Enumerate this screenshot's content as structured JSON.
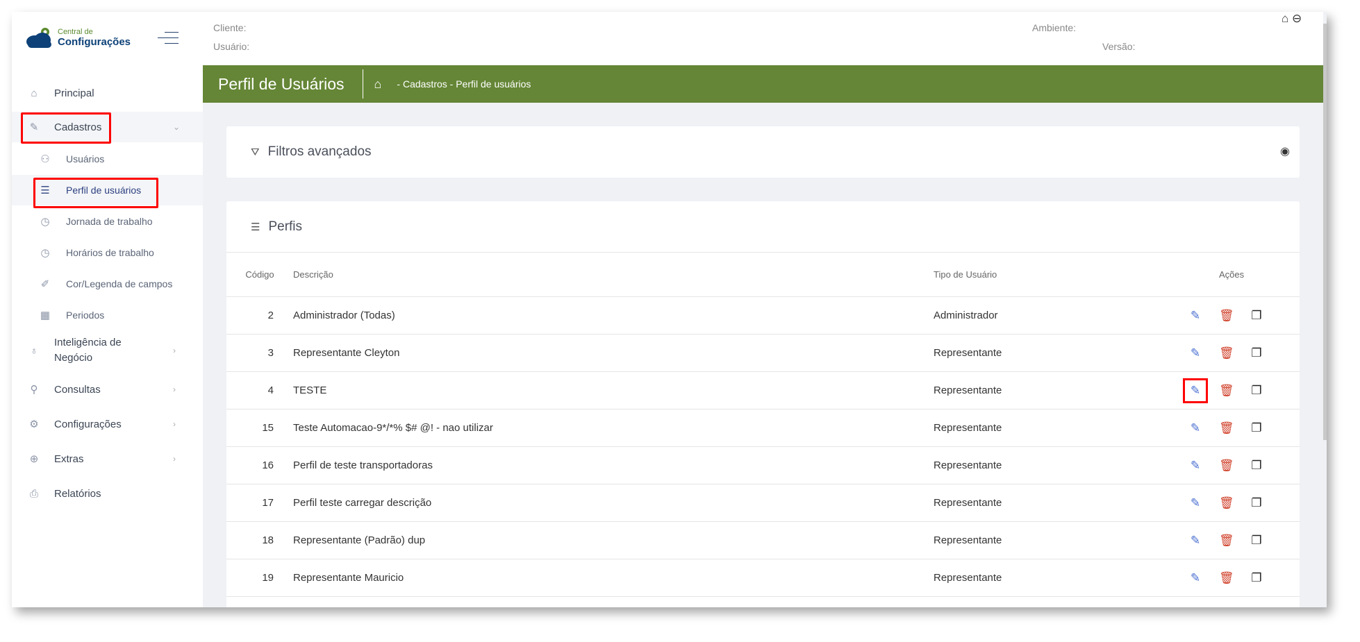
{
  "app": {
    "logo_line1": "Central de",
    "logo_line2": "Configurações"
  },
  "header": {
    "cliente_label": "Cliente:",
    "usuario_label": "Usuário:",
    "ambiente_label": "Ambiente:",
    "versao_label": "Versão:"
  },
  "page": {
    "title": "Perfil de Usuários",
    "breadcrumb": "- Cadastros - Perfil de usuários"
  },
  "sidebar": {
    "items": [
      {
        "label": "Principal",
        "icon": "home-icon"
      },
      {
        "label": "Cadastros",
        "icon": "edit-icon"
      },
      {
        "label": "Usuários",
        "icon": "users-icon"
      },
      {
        "label": "Perfil de usuários",
        "icon": "checklist-icon"
      },
      {
        "label": "Jornada de trabalho",
        "icon": "clock-icon"
      },
      {
        "label": "Horários de trabalho",
        "icon": "clock-icon"
      },
      {
        "label": "Cor/Legenda de campos",
        "icon": "pencil-icon"
      },
      {
        "label": "Periodos",
        "icon": "calendar-icon"
      },
      {
        "label": "Inteligência de",
        "label2": "Negócio",
        "icon": "lightbulb-icon"
      },
      {
        "label": "Consultas",
        "icon": "search-icon"
      },
      {
        "label": "Configurações",
        "icon": "gear-icon"
      },
      {
        "label": "Extras",
        "icon": "plus-circle-icon"
      },
      {
        "label": "Relatórios",
        "icon": "printer-icon"
      }
    ]
  },
  "filters": {
    "title": "Filtros avançados"
  },
  "table": {
    "title": "Perfis",
    "columns": [
      "Código",
      "Descrição",
      "Tipo de Usuário",
      "Ações"
    ],
    "rows": [
      {
        "code": "2",
        "desc": "Administrador (Todas)",
        "type": "Administrador"
      },
      {
        "code": "3",
        "desc": "Representante Cleyton",
        "type": "Representante"
      },
      {
        "code": "4",
        "desc": "TESTE",
        "type": "Representante"
      },
      {
        "code": "15",
        "desc": "Teste Automacao-9*/*% $# @! - nao utilizar",
        "type": "Representante"
      },
      {
        "code": "16",
        "desc": "Perfil de teste transportadoras",
        "type": "Representante"
      },
      {
        "code": "17",
        "desc": "Perfil teste carregar descrição",
        "type": "Representante"
      },
      {
        "code": "18",
        "desc": "Representante (Padrão) dup",
        "type": "Representante"
      },
      {
        "code": "19",
        "desc": "Representante Mauricio",
        "type": "Representante"
      }
    ]
  },
  "colors": {
    "green": "#658636",
    "edit": "#4a6fd1",
    "delete": "#d0402a"
  }
}
